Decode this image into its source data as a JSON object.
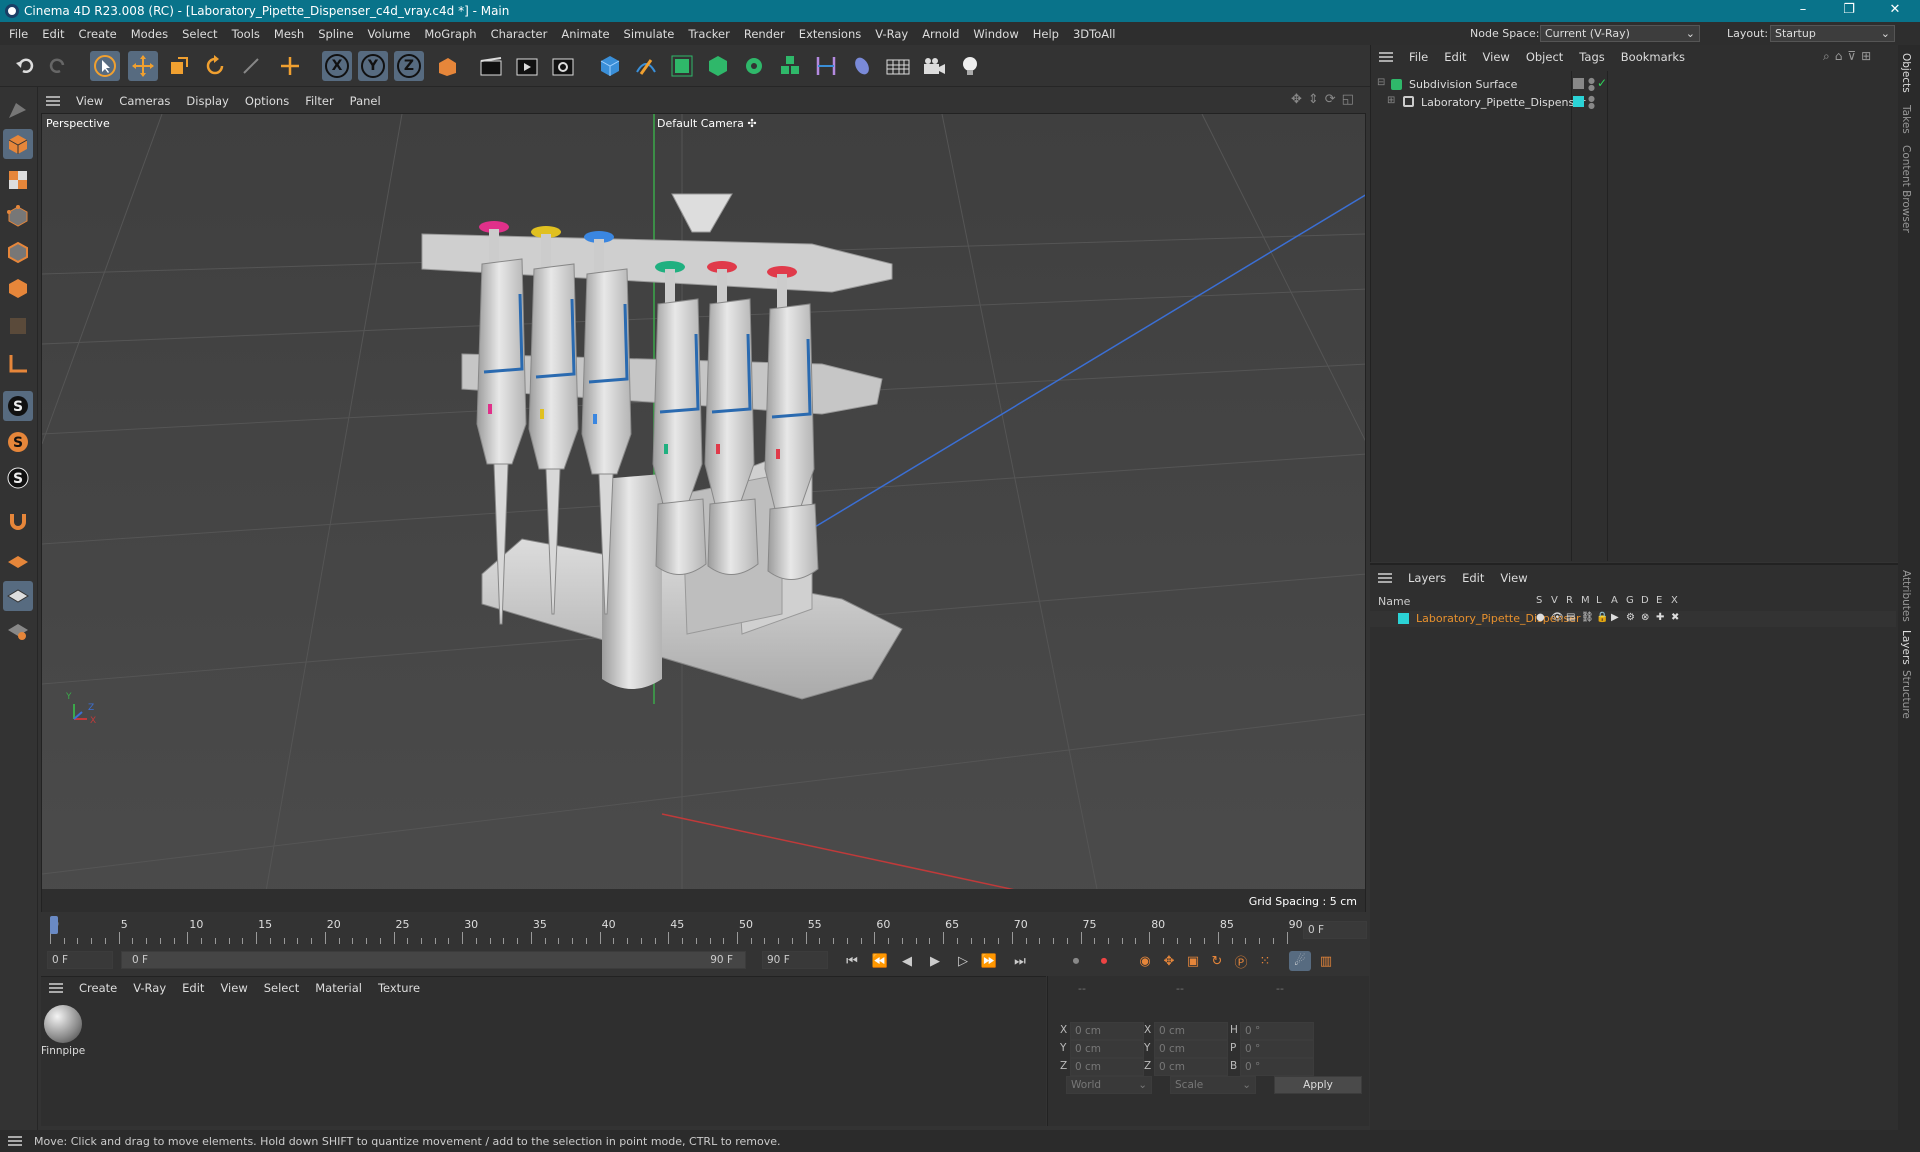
{
  "app": {
    "title": "Cinema 4D R23.008 (RC) - [Laboratory_Pipette_Dispenser_c4d_vray.c4d *] - Main",
    "node_space_label": "Node Space:",
    "node_space_value": "Current (V-Ray)",
    "layout_label": "Layout:",
    "layout_value": "Startup",
    "minimize": "–",
    "maximize": "❐",
    "close": "✕"
  },
  "menu": [
    "File",
    "Edit",
    "Create",
    "Modes",
    "Select",
    "Tools",
    "Mesh",
    "Spline",
    "Volume",
    "MoGraph",
    "Character",
    "Animate",
    "Simulate",
    "Tracker",
    "Render",
    "Extensions",
    "V-Ray",
    "Arnold",
    "Window",
    "Help",
    "3DToAll"
  ],
  "toolbar": {
    "axis_x": "X",
    "axis_y": "Y",
    "axis_z": "Z"
  },
  "viewport": {
    "menu": [
      "View",
      "Cameras",
      "Display",
      "Options",
      "Filter",
      "Panel"
    ],
    "label": "Perspective",
    "camera": "Default Camera",
    "camera_icon": "✣",
    "grid_spacing": "Grid Spacing : 5 cm",
    "axis_y": "Y",
    "axis_z": "Z",
    "axis_x": "X"
  },
  "timeline": {
    "ticks": [
      "0",
      "5",
      "10",
      "15",
      "20",
      "25",
      "30",
      "35",
      "40",
      "45",
      "50",
      "55",
      "60",
      "65",
      "70",
      "75",
      "80",
      "85",
      "90"
    ],
    "current_frame": "0 F",
    "start": "0 F",
    "range_start": "0 F",
    "range_end": "90 F",
    "end": "90 F"
  },
  "materials": {
    "menu": [
      "Create",
      "V-Ray",
      "Edit",
      "View",
      "Select",
      "Material",
      "Texture"
    ],
    "items": [
      {
        "name": "Finnpipe"
      }
    ]
  },
  "coords": {
    "headers": [
      "--",
      "--",
      "--"
    ],
    "rows": [
      {
        "a": "X",
        "av": "0 cm",
        "b": "X",
        "bv": "0 cm",
        "c": "H",
        "cv": "0 °"
      },
      {
        "a": "Y",
        "av": "0 cm",
        "b": "Y",
        "bv": "0 cm",
        "c": "P",
        "cv": "0 °"
      },
      {
        "a": "Z",
        "av": "0 cm",
        "b": "Z",
        "bv": "0 cm",
        "c": "B",
        "cv": "0 °"
      }
    ],
    "world": "World",
    "scale": "Scale",
    "apply": "Apply"
  },
  "objects": {
    "menu": [
      "File",
      "Edit",
      "View",
      "Object",
      "Tags",
      "Bookmarks"
    ],
    "items": [
      {
        "name": "Subdivision Surface"
      },
      {
        "name": "Laboratory_Pipette_Dispenser"
      }
    ]
  },
  "layers": {
    "menu": [
      "Layers",
      "Edit",
      "View"
    ],
    "col_name": "Name",
    "cols": [
      "S",
      "V",
      "R",
      "M",
      "L",
      "A",
      "G",
      "D",
      "E",
      "X"
    ],
    "items": [
      {
        "name": "Laboratory_Pipette_Dispenser",
        "color": "#2bd3d6"
      }
    ]
  },
  "side_tabs": [
    "Objects",
    "Takes",
    "Content Browser",
    "Attributes",
    "Layers",
    "Structure"
  ],
  "status": "Move: Click and drag to move elements. Hold down SHIFT to quantize movement / add to the selection in point mode, CTRL to remove.",
  "colors": {
    "titlebar": "#09738a",
    "accent": "#576b80",
    "layer_name": "#e8912d",
    "layer_swatch": "#2bd3d6"
  }
}
